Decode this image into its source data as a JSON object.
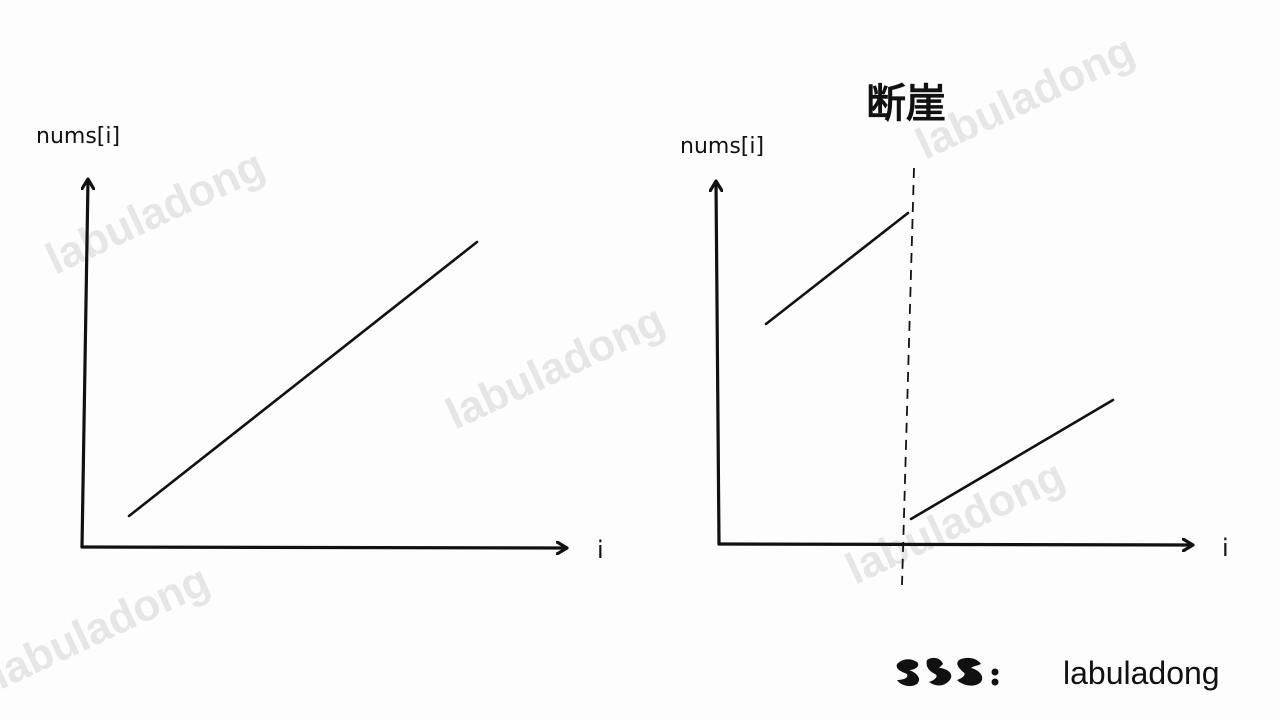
{
  "watermark_text": "labuladong",
  "left_plot": {
    "y_axis_label": "nums[i]",
    "x_axis_label": "i"
  },
  "right_plot": {
    "y_axis_label": "nums[i]",
    "x_axis_label": "i",
    "cliff_label": "断崖"
  },
  "signature": {
    "brand": "labuladong"
  },
  "colors": {
    "ink": "#111111",
    "watermark": "#e6e6e6",
    "background": "#fdfdfd"
  }
}
